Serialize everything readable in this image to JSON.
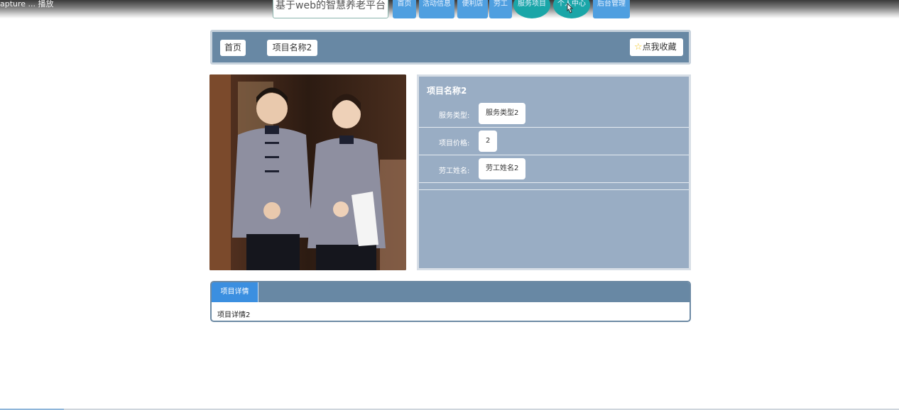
{
  "window": {
    "title": "apture ... 播放"
  },
  "header": {
    "site_title": "基于web的智慧养老平台",
    "nav": [
      {
        "label": "首页"
      },
      {
        "label": "活动信息"
      },
      {
        "label": "便利店"
      },
      {
        "label": "劳工"
      },
      {
        "label": "服务项目"
      },
      {
        "label": "个人中心"
      },
      {
        "label": "后台管理"
      }
    ]
  },
  "breadcrumb": {
    "home": "首页",
    "current": "项目名称2",
    "favorite_label": "点我收藏",
    "favorite_icon": "star-icon"
  },
  "product": {
    "image_alt": "service staff photo",
    "title": "项目名称2",
    "fields": [
      {
        "label": "服务类型:",
        "value": "服务类型2"
      },
      {
        "label": "项目价格:",
        "value": "2"
      },
      {
        "label": "劳工姓名:",
        "value": "劳工姓名2"
      }
    ]
  },
  "details": {
    "tab_label": "项目详情",
    "content": "项目详情2"
  },
  "colors": {
    "nav_blue": "#4f9fe0",
    "nav_teal": "#1aa6a8",
    "bar_slate": "#6888a4",
    "panel_blue": "#99adc4",
    "tab_active": "#3b8fe0"
  }
}
